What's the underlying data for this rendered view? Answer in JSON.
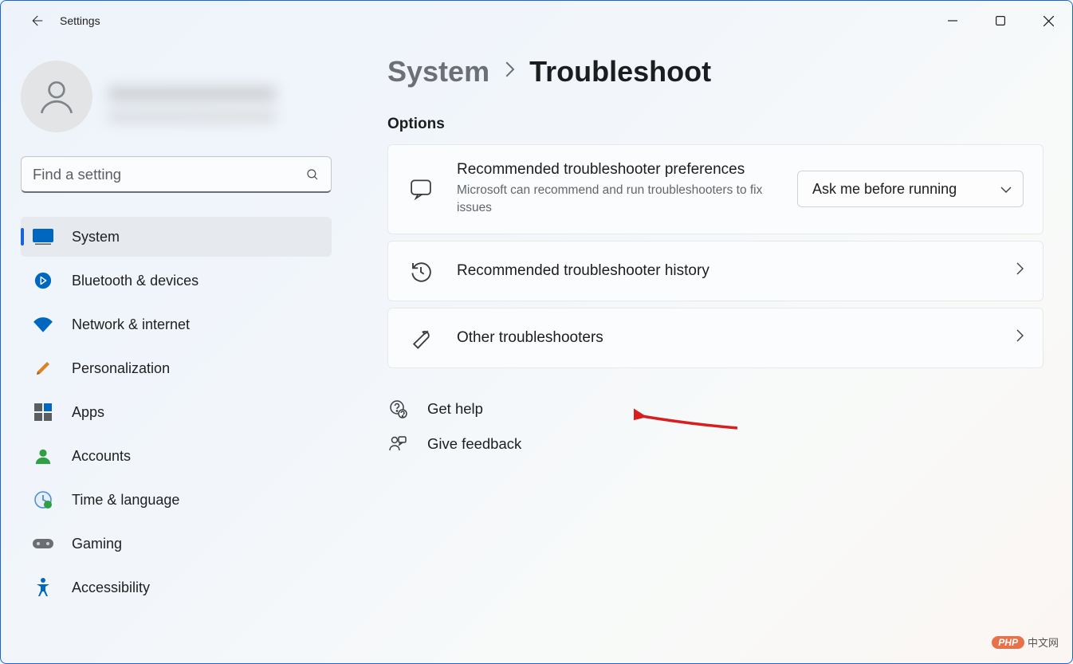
{
  "app": {
    "title": "Settings"
  },
  "search": {
    "placeholder": "Find a setting"
  },
  "sidebar": {
    "items": [
      {
        "label": "System"
      },
      {
        "label": "Bluetooth & devices"
      },
      {
        "label": "Network & internet"
      },
      {
        "label": "Personalization"
      },
      {
        "label": "Apps"
      },
      {
        "label": "Accounts"
      },
      {
        "label": "Time & language"
      },
      {
        "label": "Gaming"
      },
      {
        "label": "Accessibility"
      }
    ]
  },
  "breadcrumb": {
    "parent": "System",
    "current": "Troubleshoot"
  },
  "main": {
    "options_label": "Options",
    "recommended": {
      "title": "Recommended troubleshooter preferences",
      "subtitle": "Microsoft can recommend and run troubleshooters to fix issues",
      "dropdown_value": "Ask me before running"
    },
    "history": {
      "title": "Recommended troubleshooter history"
    },
    "other": {
      "title": "Other troubleshooters"
    }
  },
  "footer": {
    "help": "Get help",
    "feedback": "Give feedback"
  },
  "watermark": {
    "brand": "PHP",
    "text": "中文网"
  }
}
